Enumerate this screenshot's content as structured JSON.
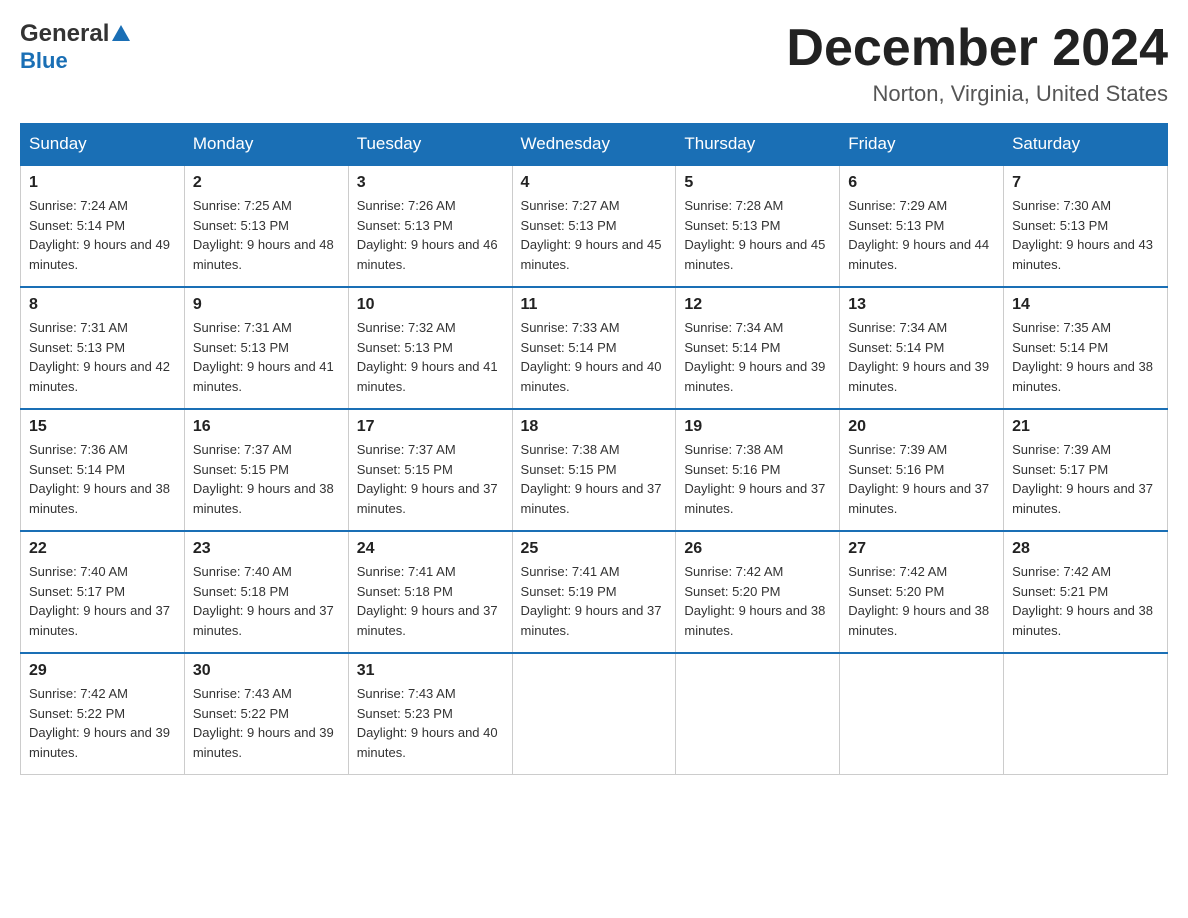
{
  "header": {
    "logo_general": "General",
    "logo_blue": "Blue",
    "month_title": "December 2024",
    "location": "Norton, Virginia, United States"
  },
  "weekdays": [
    "Sunday",
    "Monday",
    "Tuesday",
    "Wednesday",
    "Thursday",
    "Friday",
    "Saturday"
  ],
  "weeks": [
    [
      {
        "day": "1",
        "sunrise": "7:24 AM",
        "sunset": "5:14 PM",
        "daylight": "9 hours and 49 minutes."
      },
      {
        "day": "2",
        "sunrise": "7:25 AM",
        "sunset": "5:13 PM",
        "daylight": "9 hours and 48 minutes."
      },
      {
        "day": "3",
        "sunrise": "7:26 AM",
        "sunset": "5:13 PM",
        "daylight": "9 hours and 46 minutes."
      },
      {
        "day": "4",
        "sunrise": "7:27 AM",
        "sunset": "5:13 PM",
        "daylight": "9 hours and 45 minutes."
      },
      {
        "day": "5",
        "sunrise": "7:28 AM",
        "sunset": "5:13 PM",
        "daylight": "9 hours and 45 minutes."
      },
      {
        "day": "6",
        "sunrise": "7:29 AM",
        "sunset": "5:13 PM",
        "daylight": "9 hours and 44 minutes."
      },
      {
        "day": "7",
        "sunrise": "7:30 AM",
        "sunset": "5:13 PM",
        "daylight": "9 hours and 43 minutes."
      }
    ],
    [
      {
        "day": "8",
        "sunrise": "7:31 AM",
        "sunset": "5:13 PM",
        "daylight": "9 hours and 42 minutes."
      },
      {
        "day": "9",
        "sunrise": "7:31 AM",
        "sunset": "5:13 PM",
        "daylight": "9 hours and 41 minutes."
      },
      {
        "day": "10",
        "sunrise": "7:32 AM",
        "sunset": "5:13 PM",
        "daylight": "9 hours and 41 minutes."
      },
      {
        "day": "11",
        "sunrise": "7:33 AM",
        "sunset": "5:14 PM",
        "daylight": "9 hours and 40 minutes."
      },
      {
        "day": "12",
        "sunrise": "7:34 AM",
        "sunset": "5:14 PM",
        "daylight": "9 hours and 39 minutes."
      },
      {
        "day": "13",
        "sunrise": "7:34 AM",
        "sunset": "5:14 PM",
        "daylight": "9 hours and 39 minutes."
      },
      {
        "day": "14",
        "sunrise": "7:35 AM",
        "sunset": "5:14 PM",
        "daylight": "9 hours and 38 minutes."
      }
    ],
    [
      {
        "day": "15",
        "sunrise": "7:36 AM",
        "sunset": "5:14 PM",
        "daylight": "9 hours and 38 minutes."
      },
      {
        "day": "16",
        "sunrise": "7:37 AM",
        "sunset": "5:15 PM",
        "daylight": "9 hours and 38 minutes."
      },
      {
        "day": "17",
        "sunrise": "7:37 AM",
        "sunset": "5:15 PM",
        "daylight": "9 hours and 37 minutes."
      },
      {
        "day": "18",
        "sunrise": "7:38 AM",
        "sunset": "5:15 PM",
        "daylight": "9 hours and 37 minutes."
      },
      {
        "day": "19",
        "sunrise": "7:38 AM",
        "sunset": "5:16 PM",
        "daylight": "9 hours and 37 minutes."
      },
      {
        "day": "20",
        "sunrise": "7:39 AM",
        "sunset": "5:16 PM",
        "daylight": "9 hours and 37 minutes."
      },
      {
        "day": "21",
        "sunrise": "7:39 AM",
        "sunset": "5:17 PM",
        "daylight": "9 hours and 37 minutes."
      }
    ],
    [
      {
        "day": "22",
        "sunrise": "7:40 AM",
        "sunset": "5:17 PM",
        "daylight": "9 hours and 37 minutes."
      },
      {
        "day": "23",
        "sunrise": "7:40 AM",
        "sunset": "5:18 PM",
        "daylight": "9 hours and 37 minutes."
      },
      {
        "day": "24",
        "sunrise": "7:41 AM",
        "sunset": "5:18 PM",
        "daylight": "9 hours and 37 minutes."
      },
      {
        "day": "25",
        "sunrise": "7:41 AM",
        "sunset": "5:19 PM",
        "daylight": "9 hours and 37 minutes."
      },
      {
        "day": "26",
        "sunrise": "7:42 AM",
        "sunset": "5:20 PM",
        "daylight": "9 hours and 38 minutes."
      },
      {
        "day": "27",
        "sunrise": "7:42 AM",
        "sunset": "5:20 PM",
        "daylight": "9 hours and 38 minutes."
      },
      {
        "day": "28",
        "sunrise": "7:42 AM",
        "sunset": "5:21 PM",
        "daylight": "9 hours and 38 minutes."
      }
    ],
    [
      {
        "day": "29",
        "sunrise": "7:42 AM",
        "sunset": "5:22 PM",
        "daylight": "9 hours and 39 minutes."
      },
      {
        "day": "30",
        "sunrise": "7:43 AM",
        "sunset": "5:22 PM",
        "daylight": "9 hours and 39 minutes."
      },
      {
        "day": "31",
        "sunrise": "7:43 AM",
        "sunset": "5:23 PM",
        "daylight": "9 hours and 40 minutes."
      },
      null,
      null,
      null,
      null
    ]
  ],
  "labels": {
    "sunrise_prefix": "Sunrise: ",
    "sunset_prefix": "Sunset: ",
    "daylight_prefix": "Daylight: "
  }
}
